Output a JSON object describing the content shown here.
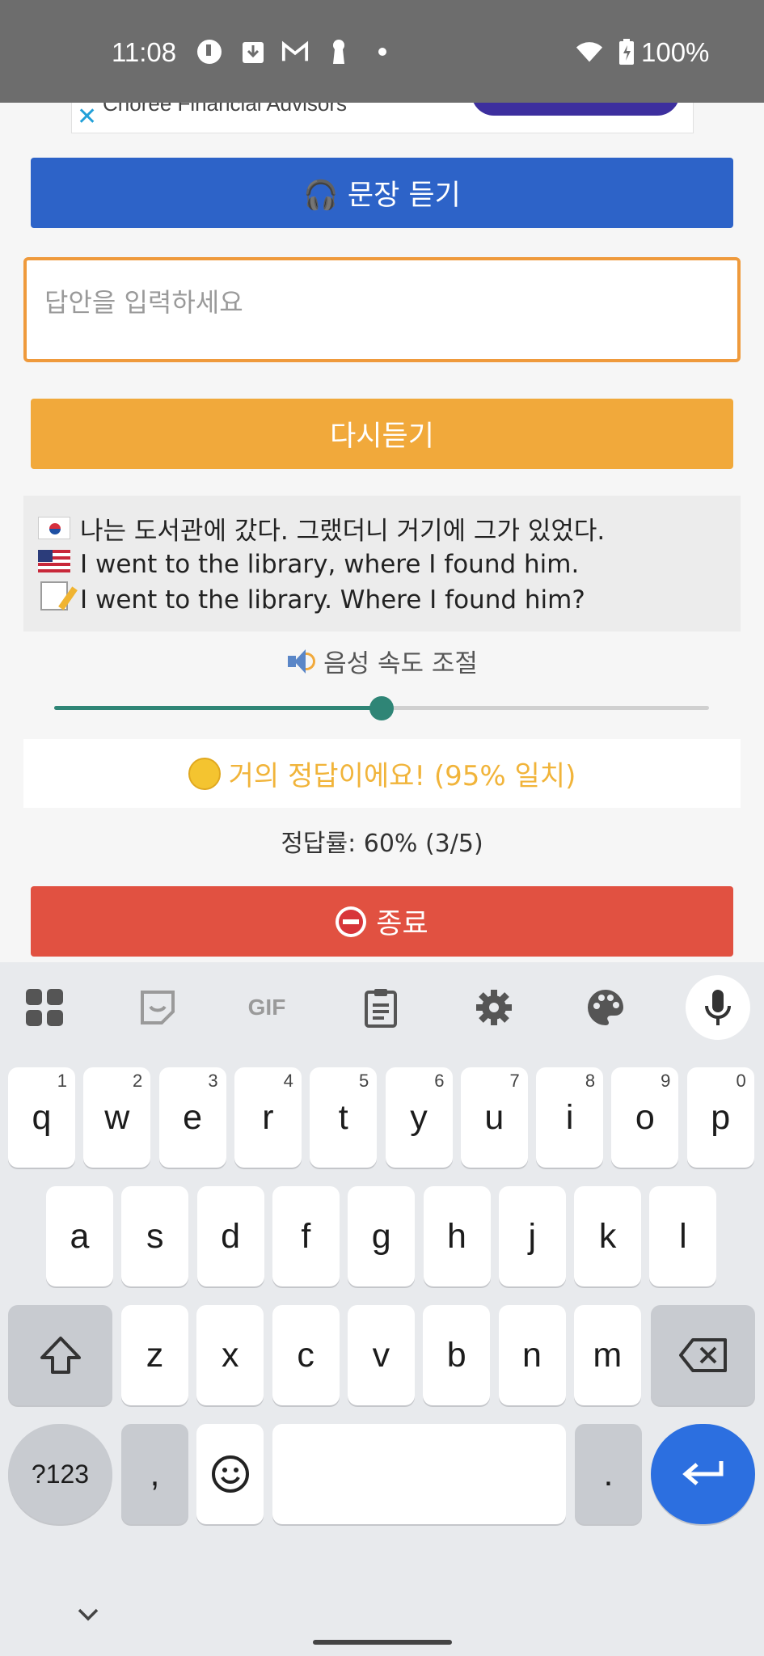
{
  "status_bar": {
    "time": "11:08",
    "battery": "100%"
  },
  "ad": {
    "text": "Choree Financial Advisors",
    "close_glyph": "✕"
  },
  "listen_button": {
    "icon": "headphones-icon",
    "label": "🎧 문장 듣기"
  },
  "answer_input": {
    "placeholder": "답안을 입력하세요",
    "value": ""
  },
  "replay_button": {
    "label": "다시듣기"
  },
  "sentences": {
    "korean": "나는 도서관에 갔다. 그랬더니 거기에 그가 있었다.",
    "english": "I went to the library, where I found him.",
    "user_answer": "I went to the library. Where I found him?"
  },
  "speed": {
    "label": "음성 속도 조절",
    "value_fraction": 0.5
  },
  "result": {
    "text": "거의 정답이에요! (95% 일치)",
    "color": "#f1b43a"
  },
  "accuracy": {
    "text": "정답률: 60% (3/5)"
  },
  "quit_button": {
    "label": "종료",
    "color": "#e15141"
  },
  "keyboard": {
    "row1": [
      {
        "k": "q",
        "h": "1"
      },
      {
        "k": "w",
        "h": "2"
      },
      {
        "k": "e",
        "h": "3"
      },
      {
        "k": "r",
        "h": "4"
      },
      {
        "k": "t",
        "h": "5"
      },
      {
        "k": "y",
        "h": "6"
      },
      {
        "k": "u",
        "h": "7"
      },
      {
        "k": "i",
        "h": "8"
      },
      {
        "k": "o",
        "h": "9"
      },
      {
        "k": "p",
        "h": "0"
      }
    ],
    "row2": [
      "a",
      "s",
      "d",
      "f",
      "g",
      "h",
      "j",
      "k",
      "l"
    ],
    "row3": [
      "z",
      "x",
      "c",
      "v",
      "b",
      "n",
      "m"
    ],
    "symbols": "?123",
    "comma": ",",
    "period": "."
  }
}
